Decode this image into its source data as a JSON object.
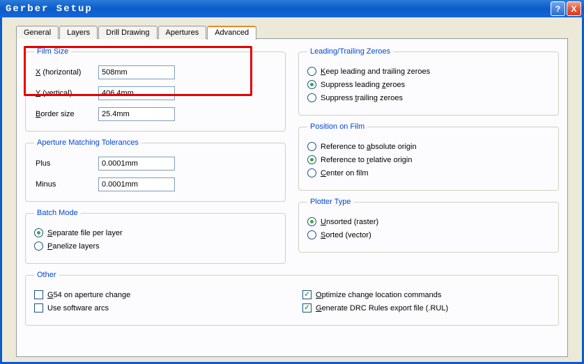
{
  "window": {
    "title": "Gerber Setup",
    "help": "?",
    "close": "X"
  },
  "tabs": [
    "General",
    "Layers",
    "Drill Drawing",
    "Apertures",
    "Advanced"
  ],
  "active_tab": 4,
  "film_size": {
    "legend": "Film Size",
    "x_label": "X (horizontal)",
    "x_value": "508mm",
    "y_label": "Y (vertical)",
    "y_value": "406.4mm",
    "border_label": "Border size",
    "border_value": "25.4mm"
  },
  "aperture_tol": {
    "legend": "Aperture Matching Tolerances",
    "plus_label": "Plus",
    "plus_value": "0.0001mm",
    "minus_label": "Minus",
    "minus_value": "0.0001mm"
  },
  "batch_mode": {
    "legend": "Batch Mode",
    "separate": "Separate file per layer",
    "panelize": "Panelize layers",
    "selected": "separate"
  },
  "zeroes": {
    "legend": "Leading/Trailing Zeroes",
    "keep": "Keep leading and trailing zeroes",
    "suppress_leading": "Suppress leading zeroes",
    "suppress_trailing": "Suppress trailing zeroes",
    "selected": "suppress_leading"
  },
  "position": {
    "legend": "Position on Film",
    "abs": "Reference to absolute origin",
    "rel": "Reference to relative origin",
    "center": "Center on film",
    "selected": "rel"
  },
  "plotter": {
    "legend": "Plotter Type",
    "unsorted": "Unsorted (raster)",
    "sorted": "Sorted (vector)",
    "selected": "unsorted"
  },
  "other": {
    "legend": "Other",
    "g54": "G54 on aperture change",
    "software_arcs": "Use software arcs",
    "optimize": "Optimize change location commands",
    "drc": "Generate DRC Rules export file (.RUL)",
    "g54_checked": false,
    "software_arcs_checked": false,
    "optimize_checked": true,
    "drc_checked": true
  }
}
